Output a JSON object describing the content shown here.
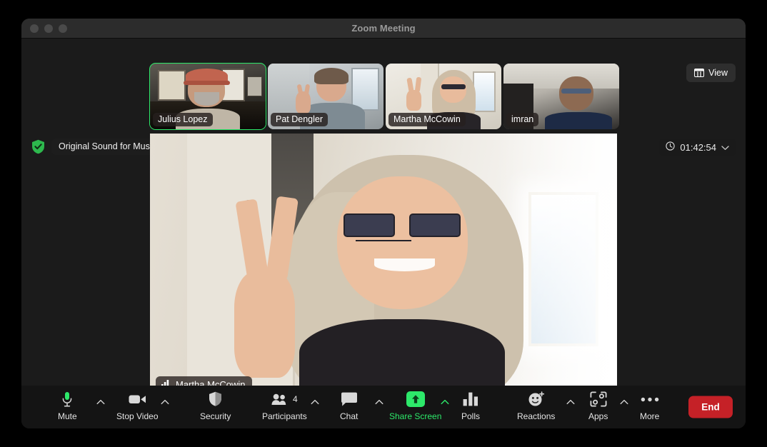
{
  "window": {
    "title": "Zoom Meeting",
    "traffic_lights": [
      "close-button",
      "minimize-button",
      "zoom-button"
    ]
  },
  "view_button": {
    "label": "View",
    "icon": "layout-grid-icon"
  },
  "original_sound": {
    "label": "Original Sound for Musicians: Off",
    "icon": "shield-check-icon",
    "accent": "#2de86a"
  },
  "timer": {
    "value": "01:42:54",
    "icon": "clock-icon",
    "caret": "chevron-down-icon"
  },
  "thumbnails": [
    {
      "name": "Julius Lopez",
      "active": true
    },
    {
      "name": "Pat Dengler",
      "active": false
    },
    {
      "name": "Martha McCowin",
      "active": false
    },
    {
      "name": "imran",
      "active": false
    }
  ],
  "main_video": {
    "name": "Martha McCowin",
    "icon": "audio-bars-icon"
  },
  "toolbar": {
    "mute": {
      "label": "Mute",
      "icon": "microphone-icon",
      "has_caret": true
    },
    "video": {
      "label": "Stop Video",
      "icon": "camera-icon",
      "has_caret": true
    },
    "security": {
      "label": "Security",
      "icon": "shield-icon",
      "has_caret": false
    },
    "participants": {
      "label": "Participants",
      "icon": "people-icon",
      "count": "4",
      "has_caret": true
    },
    "chat": {
      "label": "Chat",
      "icon": "speech-bubble-icon",
      "has_caret": true
    },
    "share": {
      "label": "Share Screen",
      "icon": "up-arrow-icon",
      "has_caret": true,
      "active": true
    },
    "polls": {
      "label": "Polls",
      "icon": "bar-chart-icon",
      "has_caret": false
    },
    "reactions": {
      "label": "Reactions",
      "icon": "smiley-plus-icon",
      "has_caret": true
    },
    "apps": {
      "label": "Apps",
      "icon": "apps-bracket-icon",
      "has_caret": true
    },
    "more": {
      "label": "More",
      "icon": "ellipsis-icon",
      "has_caret": false
    },
    "end": {
      "label": "End"
    }
  },
  "colors": {
    "accent_green": "#2de86a",
    "end_red": "#c52127",
    "window_bg": "#1b1b1b",
    "titlebar": "#2c2c2c",
    "toolbar": "#141414"
  }
}
